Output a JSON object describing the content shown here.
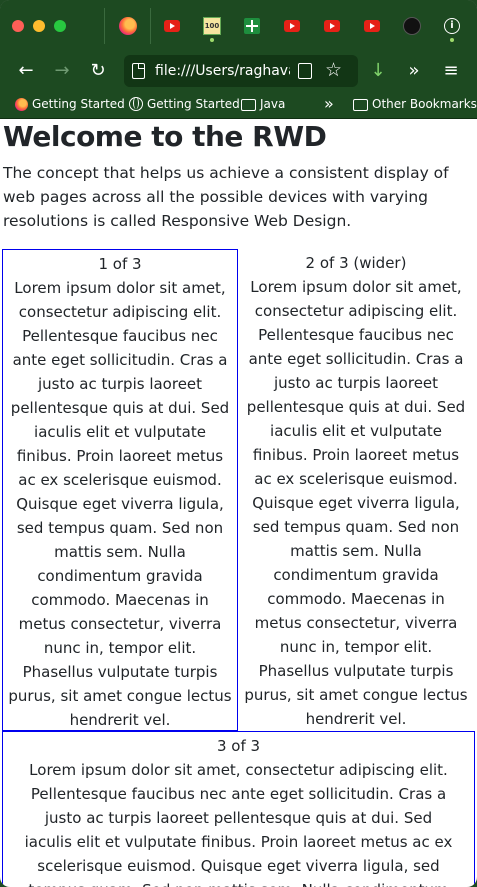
{
  "browser": {
    "url": "file:///Users/raghavan",
    "bookmarks": [
      {
        "label": "Getting Started",
        "icon": "firefox-icon"
      },
      {
        "label": "Getting Started",
        "icon": "globe-icon"
      },
      {
        "label": "Java",
        "icon": "folder-icon"
      },
      {
        "label": "Other Bookmarks",
        "icon": "folder-icon"
      }
    ],
    "overflow_glyph": "»",
    "colors": {
      "chrome": "#1d4a21",
      "url_bg": "#123615",
      "box_border": "#0000ee"
    }
  },
  "page": {
    "heading": "Welcome to the RWD",
    "intro": "The concept that helps us achieve a consistent display of web pages across all the possible devices with varying resolutions is called Responsive Web Design.",
    "columns": [
      {
        "title": "1 of 3",
        "text": "Lorem ipsum dolor sit amet, consectetur adipiscing elit. Pellentesque faucibus nec ante eget sollicitudin. Cras a justo ac turpis laoreet pellentesque quis at dui. Sed iaculis elit et vulputate finibus. Proin laoreet metus ac ex scelerisque euismod. Quisque eget viverra ligula, sed tempus quam. Sed non mattis sem. Nulla condimentum gravida commodo. Maecenas in metus consectetur, viverra nunc in, tempor elit. Phasellus vulputate turpis purus, sit amet congue lectus hendrerit vel."
      },
      {
        "title": "2 of 3 (wider)",
        "text": "Lorem ipsum dolor sit amet, consectetur adipiscing elit. Pellentesque faucibus nec ante eget sollicitudin. Cras a justo ac turpis laoreet pellentesque quis at dui. Sed iaculis elit et vulputate finibus. Proin laoreet metus ac ex scelerisque euismod. Quisque eget viverra ligula, sed tempus quam. Sed non mattis sem. Nulla condimentum gravida commodo. Maecenas in metus consectetur, viverra nunc in, tempor elit. Phasellus vulputate turpis purus, sit amet congue lectus hendrerit vel."
      },
      {
        "title": "3 of 3",
        "text": "Lorem ipsum dolor sit amet, consectetur adipiscing elit. Pellentesque faucibus nec ante eget sollicitudin. Cras a justo ac turpis laoreet pellentesque quis at dui. Sed iaculis elit et vulputate finibus. Proin laoreet metus ac ex scelerisque euismod. Quisque eget viverra ligula, sed tempus quam. Sed non mattis sem. Nulla condimentum gravida commodo."
      }
    ]
  }
}
